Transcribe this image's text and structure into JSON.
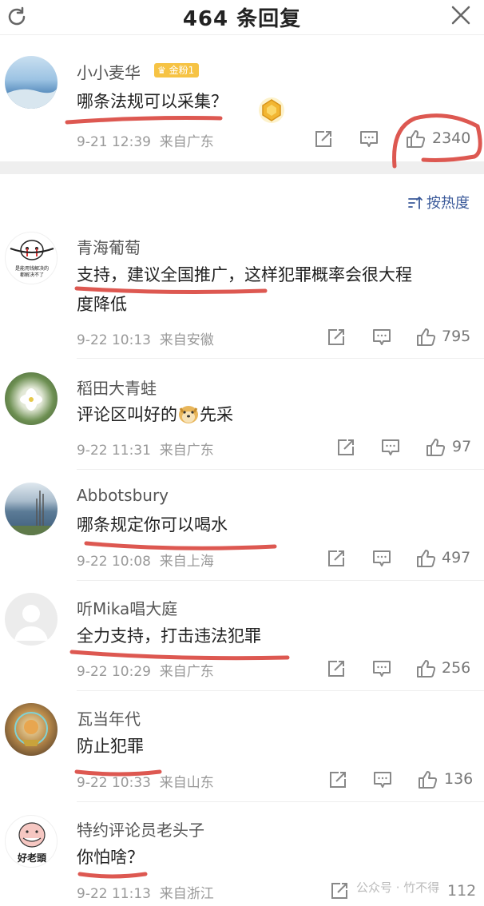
{
  "header": {
    "title": "464 条回复",
    "refresh_icon": "refresh-icon",
    "close_icon": "close-icon"
  },
  "main_comment": {
    "author": "小小麦华",
    "badge": "金粉1",
    "text": "哪条法规可以采集？",
    "time": "9-21 12:39",
    "source": "来自广东",
    "likes": "2340"
  },
  "sort": {
    "label": "按热度",
    "icon": "sort-icon"
  },
  "comments": [
    {
      "author": "青海葡萄",
      "text_line1": "支持，建议全国推广，这样犯罪概率会很大程",
      "text_line2": "度降低",
      "time": "9-22 10:13",
      "source": "来自安徽",
      "likes": "795",
      "avatar_text_1": "是能用钱解决的",
      "avatar_text_2": "都解决不了"
    },
    {
      "author": "稻田大青蛙",
      "text": "评论区叫好的",
      "text_after": "先采",
      "time": "9-22 11:31",
      "source": "来自广东",
      "likes": "97"
    },
    {
      "author": "Abbotsbury",
      "text": "哪条规定你可以喝水",
      "time": "9-22 10:08",
      "source": "来自上海",
      "likes": "497"
    },
    {
      "author": "听Mika唱大庭",
      "text": "全力支持，打击违法犯罪",
      "time": "9-22 10:29",
      "source": "来自广东",
      "likes": "256"
    },
    {
      "author": "瓦当年代",
      "text": "防止犯罪",
      "time": "9-22 10:33",
      "source": "来自山东",
      "likes": "136"
    },
    {
      "author": "特约评论员老头子",
      "text": "你怕啥？",
      "time": "9-22 11:13",
      "source": "来自浙江",
      "likes": "112",
      "avatar_text": "好老頭"
    }
  ],
  "watermark": "公众号 · 竹不得",
  "colors": {
    "accent": "#3b5a9a",
    "annotation": "#d9463e",
    "badge": "#f6c344"
  }
}
